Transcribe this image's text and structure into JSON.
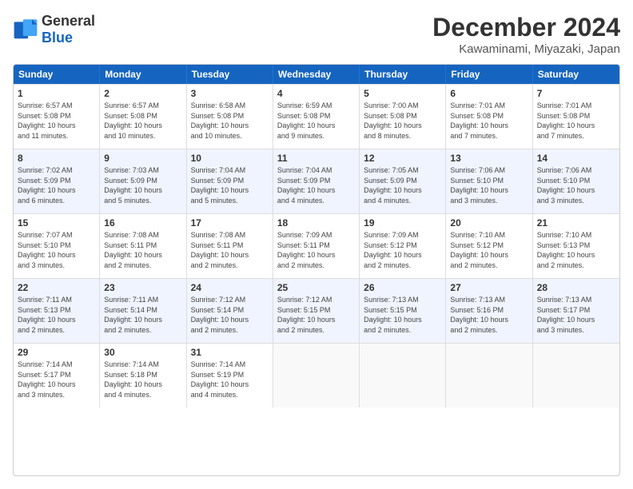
{
  "logo": {
    "general": "General",
    "blue": "Blue"
  },
  "title": "December 2024",
  "subtitle": "Kawaminami, Miyazaki, Japan",
  "headers": [
    "Sunday",
    "Monday",
    "Tuesday",
    "Wednesday",
    "Thursday",
    "Friday",
    "Saturday"
  ],
  "rows": [
    [
      {
        "day": "1",
        "lines": [
          "Sunrise: 6:57 AM",
          "Sunset: 5:08 PM",
          "Daylight: 10 hours",
          "and 11 minutes."
        ]
      },
      {
        "day": "2",
        "lines": [
          "Sunrise: 6:57 AM",
          "Sunset: 5:08 PM",
          "Daylight: 10 hours",
          "and 10 minutes."
        ]
      },
      {
        "day": "3",
        "lines": [
          "Sunrise: 6:58 AM",
          "Sunset: 5:08 PM",
          "Daylight: 10 hours",
          "and 10 minutes."
        ]
      },
      {
        "day": "4",
        "lines": [
          "Sunrise: 6:59 AM",
          "Sunset: 5:08 PM",
          "Daylight: 10 hours",
          "and 9 minutes."
        ]
      },
      {
        "day": "5",
        "lines": [
          "Sunrise: 7:00 AM",
          "Sunset: 5:08 PM",
          "Daylight: 10 hours",
          "and 8 minutes."
        ]
      },
      {
        "day": "6",
        "lines": [
          "Sunrise: 7:01 AM",
          "Sunset: 5:08 PM",
          "Daylight: 10 hours",
          "and 7 minutes."
        ]
      },
      {
        "day": "7",
        "lines": [
          "Sunrise: 7:01 AM",
          "Sunset: 5:08 PM",
          "Daylight: 10 hours",
          "and 7 minutes."
        ]
      }
    ],
    [
      {
        "day": "8",
        "lines": [
          "Sunrise: 7:02 AM",
          "Sunset: 5:09 PM",
          "Daylight: 10 hours",
          "and 6 minutes."
        ]
      },
      {
        "day": "9",
        "lines": [
          "Sunrise: 7:03 AM",
          "Sunset: 5:09 PM",
          "Daylight: 10 hours",
          "and 5 minutes."
        ]
      },
      {
        "day": "10",
        "lines": [
          "Sunrise: 7:04 AM",
          "Sunset: 5:09 PM",
          "Daylight: 10 hours",
          "and 5 minutes."
        ]
      },
      {
        "day": "11",
        "lines": [
          "Sunrise: 7:04 AM",
          "Sunset: 5:09 PM",
          "Daylight: 10 hours",
          "and 4 minutes."
        ]
      },
      {
        "day": "12",
        "lines": [
          "Sunrise: 7:05 AM",
          "Sunset: 5:09 PM",
          "Daylight: 10 hours",
          "and 4 minutes."
        ]
      },
      {
        "day": "13",
        "lines": [
          "Sunrise: 7:06 AM",
          "Sunset: 5:10 PM",
          "Daylight: 10 hours",
          "and 3 minutes."
        ]
      },
      {
        "day": "14",
        "lines": [
          "Sunrise: 7:06 AM",
          "Sunset: 5:10 PM",
          "Daylight: 10 hours",
          "and 3 minutes."
        ]
      }
    ],
    [
      {
        "day": "15",
        "lines": [
          "Sunrise: 7:07 AM",
          "Sunset: 5:10 PM",
          "Daylight: 10 hours",
          "and 3 minutes."
        ]
      },
      {
        "day": "16",
        "lines": [
          "Sunrise: 7:08 AM",
          "Sunset: 5:11 PM",
          "Daylight: 10 hours",
          "and 2 minutes."
        ]
      },
      {
        "day": "17",
        "lines": [
          "Sunrise: 7:08 AM",
          "Sunset: 5:11 PM",
          "Daylight: 10 hours",
          "and 2 minutes."
        ]
      },
      {
        "day": "18",
        "lines": [
          "Sunrise: 7:09 AM",
          "Sunset: 5:11 PM",
          "Daylight: 10 hours",
          "and 2 minutes."
        ]
      },
      {
        "day": "19",
        "lines": [
          "Sunrise: 7:09 AM",
          "Sunset: 5:12 PM",
          "Daylight: 10 hours",
          "and 2 minutes."
        ]
      },
      {
        "day": "20",
        "lines": [
          "Sunrise: 7:10 AM",
          "Sunset: 5:12 PM",
          "Daylight: 10 hours",
          "and 2 minutes."
        ]
      },
      {
        "day": "21",
        "lines": [
          "Sunrise: 7:10 AM",
          "Sunset: 5:13 PM",
          "Daylight: 10 hours",
          "and 2 minutes."
        ]
      }
    ],
    [
      {
        "day": "22",
        "lines": [
          "Sunrise: 7:11 AM",
          "Sunset: 5:13 PM",
          "Daylight: 10 hours",
          "and 2 minutes."
        ]
      },
      {
        "day": "23",
        "lines": [
          "Sunrise: 7:11 AM",
          "Sunset: 5:14 PM",
          "Daylight: 10 hours",
          "and 2 minutes."
        ]
      },
      {
        "day": "24",
        "lines": [
          "Sunrise: 7:12 AM",
          "Sunset: 5:14 PM",
          "Daylight: 10 hours",
          "and 2 minutes."
        ]
      },
      {
        "day": "25",
        "lines": [
          "Sunrise: 7:12 AM",
          "Sunset: 5:15 PM",
          "Daylight: 10 hours",
          "and 2 minutes."
        ]
      },
      {
        "day": "26",
        "lines": [
          "Sunrise: 7:13 AM",
          "Sunset: 5:15 PM",
          "Daylight: 10 hours",
          "and 2 minutes."
        ]
      },
      {
        "day": "27",
        "lines": [
          "Sunrise: 7:13 AM",
          "Sunset: 5:16 PM",
          "Daylight: 10 hours",
          "and 2 minutes."
        ]
      },
      {
        "day": "28",
        "lines": [
          "Sunrise: 7:13 AM",
          "Sunset: 5:17 PM",
          "Daylight: 10 hours",
          "and 3 minutes."
        ]
      }
    ],
    [
      {
        "day": "29",
        "lines": [
          "Sunrise: 7:14 AM",
          "Sunset: 5:17 PM",
          "Daylight: 10 hours",
          "and 3 minutes."
        ]
      },
      {
        "day": "30",
        "lines": [
          "Sunrise: 7:14 AM",
          "Sunset: 5:18 PM",
          "Daylight: 10 hours",
          "and 4 minutes."
        ]
      },
      {
        "day": "31",
        "lines": [
          "Sunrise: 7:14 AM",
          "Sunset: 5:19 PM",
          "Daylight: 10 hours",
          "and 4 minutes."
        ]
      },
      {
        "day": "",
        "lines": []
      },
      {
        "day": "",
        "lines": []
      },
      {
        "day": "",
        "lines": []
      },
      {
        "day": "",
        "lines": []
      }
    ]
  ]
}
